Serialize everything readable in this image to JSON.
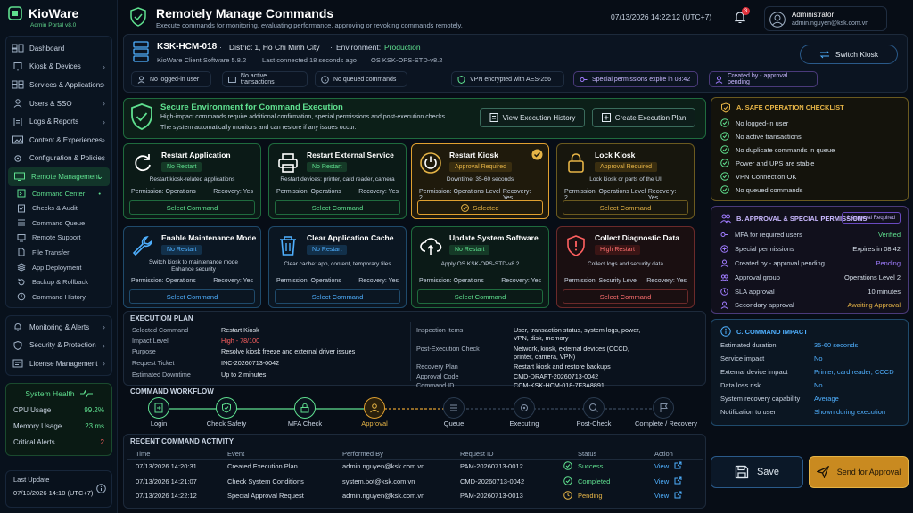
{
  "app": {
    "name": "KioWare",
    "version": "Admin Portal v8.0"
  },
  "sidebar": {
    "items": [
      {
        "label": "Dashboard"
      },
      {
        "label": "Kiosk & Devices"
      },
      {
        "label": "Services & Applications"
      },
      {
        "label": "Users & SSO"
      },
      {
        "label": "Logs & Reports"
      },
      {
        "label": "Content & Experiences"
      },
      {
        "label": "Configuration & Policies"
      },
      {
        "label": "Remote Management"
      }
    ],
    "subitems": [
      {
        "label": "Command Center"
      },
      {
        "label": "Checks & Audit"
      },
      {
        "label": "Command Queue"
      },
      {
        "label": "Remote Support"
      },
      {
        "label": "File Transfer"
      },
      {
        "label": "App Deployment"
      },
      {
        "label": "Backup & Rollback"
      },
      {
        "label": "Command History"
      }
    ],
    "bottom_items": [
      {
        "label": "Monitoring & Alerts"
      },
      {
        "label": "Security & Protection"
      },
      {
        "label": "License Management"
      }
    ]
  },
  "health": {
    "title": "System Health",
    "cpu_label": "CPU Usage",
    "cpu": "99.2%",
    "mem_label": "Memory Usage",
    "mem": "23 ms",
    "alerts_label": "Critical Alerts",
    "alerts": "2"
  },
  "last_update": {
    "label": "Last Update",
    "value": "07/13/2026 14:10 (UTC+7)"
  },
  "header": {
    "title": "Remotely Manage Commands",
    "subtitle": "Execute commands for monitoring, evaluating performance, approving or revoking commands remotely.",
    "datetime": "07/13/2026  14:22:12 (UTC+7)",
    "notif_count": "3",
    "user_name": "Administrator",
    "user_email": "admin.nguyen@ksk.com.vn"
  },
  "kiosk": {
    "id": "KSK-HCM-018",
    "location": "District 1, Ho Chi Minh City",
    "env_label": "Environment:",
    "env": "Production",
    "software": "KioWare Client Software 5.8.2",
    "last_connected": "Last connected 18 seconds ago",
    "os": "OS KSK-OPS-STD-v8.2",
    "switch_label": "Switch Kiosk",
    "tags": [
      "No logged-in user",
      "No active transactions",
      "No queued commands",
      "VPN encrypted with AES-256",
      "Special permissions expire in 08:42",
      "Created by - approval pending"
    ]
  },
  "secure": {
    "title": "Secure Environment for Command Execution",
    "line1": "High-impact commands require additional confirmation, special permissions and post-execution checks.",
    "line2": "The system automatically monitors and can restore if any issues occur.",
    "history_btn": "View Execution History",
    "create_btn": "Create Execution Plan"
  },
  "commands": [
    {
      "title": "Restart Application",
      "badge": "No Restart",
      "desc": "Restart kiosk-related applications",
      "perm": "Permission: Operations",
      "rec": "Recovery: Yes",
      "btn": "Select Command"
    },
    {
      "title": "Restart External Service",
      "badge": "No Restart",
      "desc": "Restart devices: printer, card reader, camera",
      "perm": "Permission: Operations",
      "rec": "Recovery: Yes",
      "btn": "Select Command"
    },
    {
      "title": "Restart Kiosk",
      "badge": "Approval Required",
      "desc": "Downtime: 35-60 seconds",
      "perm": "Permission: Operations Level 2",
      "rec": "Recovery: Yes",
      "btn": "Selected"
    },
    {
      "title": "Lock Kiosk",
      "badge": "Approval Required",
      "desc": "Lock kiosk or parts of the UI",
      "perm": "Permission: Operations Level 2",
      "rec": "Recovery: Yes",
      "btn": "Select Command"
    },
    {
      "title": "Enable Maintenance Mode",
      "badge": "No Restart",
      "desc": "Switch kiosk to maintenance mode Enhance security",
      "perm": "Permission: Operations",
      "rec": "Recovery: Yes",
      "btn": "Select Command"
    },
    {
      "title": "Clear Application Cache",
      "badge": "No Restart",
      "desc": "Clear cache: app, content, temporary files",
      "perm": "Permission: Operations",
      "rec": "Recovery: Yes",
      "btn": "Select Command"
    },
    {
      "title": "Update System Software",
      "badge": "No Restart",
      "desc": "Apply OS KSK-OPS-STD-v8.2",
      "perm": "Permission: Operations",
      "rec": "Recovery: Yes",
      "btn": "Select Command"
    },
    {
      "title": "Collect Diagnostic Data",
      "badge": "High Restart",
      "desc": "Collect logs and security data",
      "perm": "Permission: Security Level",
      "rec": "Recovery: Yes",
      "btn": "Select Command"
    }
  ],
  "plan": {
    "title": "EXECUTION PLAN",
    "left": [
      {
        "k": "Selected Command",
        "v": "Restart Kiosk"
      },
      {
        "k": "Impact Level",
        "v": "High - 78/100"
      },
      {
        "k": "Purpose",
        "v": "Resolve kiosk freeze and external driver issues"
      },
      {
        "k": "Request Ticket",
        "v": "INC-20260713-0042"
      },
      {
        "k": "Estimated Downtime",
        "v": "Up to 2 minutes"
      }
    ],
    "right": [
      {
        "k": "Inspection Items",
        "v": "User, transaction status, system logs, power, VPN, disk, memory"
      },
      {
        "k": "Post-Execution Check",
        "v": "Network, kiosk, external devices (CCCD, printer, camera, VPN)"
      },
      {
        "k": "Recovery Plan",
        "v": "Restart kiosk and restore backups"
      },
      {
        "k": "Approval Code",
        "v": "CMD-DRAFT-20260713-0042"
      },
      {
        "k": "Command ID",
        "v": "CCM-KSK-HCM-018-7F3A8891"
      }
    ]
  },
  "workflow": {
    "title": "COMMAND WORKFLOW",
    "steps": [
      "Login",
      "Check Safety",
      "MFA Check",
      "Approval",
      "Queue",
      "Executing",
      "Post-Check",
      "Complete / Recovery"
    ]
  },
  "activity": {
    "title": "RECENT COMMAND ACTIVITY",
    "headers": [
      "Time",
      "Event",
      "Performed By",
      "Request ID",
      "Status",
      "Action"
    ],
    "rows": [
      {
        "time": "07/13/2026 14:20:31",
        "event": "Created Execution Plan",
        "by": "admin.nguyen@ksk.com.vn",
        "req": "PAM-20260713-0012",
        "status": "Success",
        "action": "View"
      },
      {
        "time": "07/13/2026 14:21:07",
        "event": "Check System Conditions",
        "by": "system.bot@ksk.com.vn",
        "req": "CMD-20260713-0042",
        "status": "Completed",
        "action": "View"
      },
      {
        "time": "07/13/2026 14:22:12",
        "event": "Special Approval Request",
        "by": "admin.nguyen@ksk.com.vn",
        "req": "PAM-20260713-0013",
        "status": "Pending",
        "action": "View"
      }
    ]
  },
  "checklist": {
    "title": "A. SAFE OPERATION CHECKLIST",
    "items": [
      "No logged-in user",
      "No active transactions",
      "No duplicate commands in queue",
      "Power and UPS are stable",
      "VPN Connection OK",
      "No queued commands"
    ]
  },
  "approval": {
    "title": "B. APPROVAL & SPECIAL PERMISSIONS",
    "badge": "1 Approval Required",
    "rows": [
      {
        "k": "MFA for required users",
        "v": "Verified"
      },
      {
        "k": "Special permissions",
        "v": "Expires in 08:42"
      },
      {
        "k": "Created by - approval pending",
        "v": "Pending"
      },
      {
        "k": "Approval group",
        "v": "Operations Level 2"
      },
      {
        "k": "SLA approval",
        "v": "10 minutes"
      },
      {
        "k": "Secondary approval",
        "v": "Awaiting Approval"
      }
    ]
  },
  "impact": {
    "title": "C. COMMAND IMPACT",
    "rows": [
      {
        "k": "Estimated duration",
        "v": "35-60 seconds"
      },
      {
        "k": "Service impact",
        "v": "No"
      },
      {
        "k": "External device impact",
        "v": "Printer, card reader, CCCD"
      },
      {
        "k": "Data loss risk",
        "v": "No"
      },
      {
        "k": "System recovery capability",
        "v": "Average"
      },
      {
        "k": "Notification to user",
        "v": "Shown during execution"
      }
    ]
  },
  "actions": {
    "save": "Save",
    "send": "Send for Approval"
  },
  "colors": {
    "accent": "#5fe08f",
    "amber": "#e6b446",
    "danger": "#ff6060",
    "blue": "#4fb0ff",
    "purple": "#a07cff"
  }
}
